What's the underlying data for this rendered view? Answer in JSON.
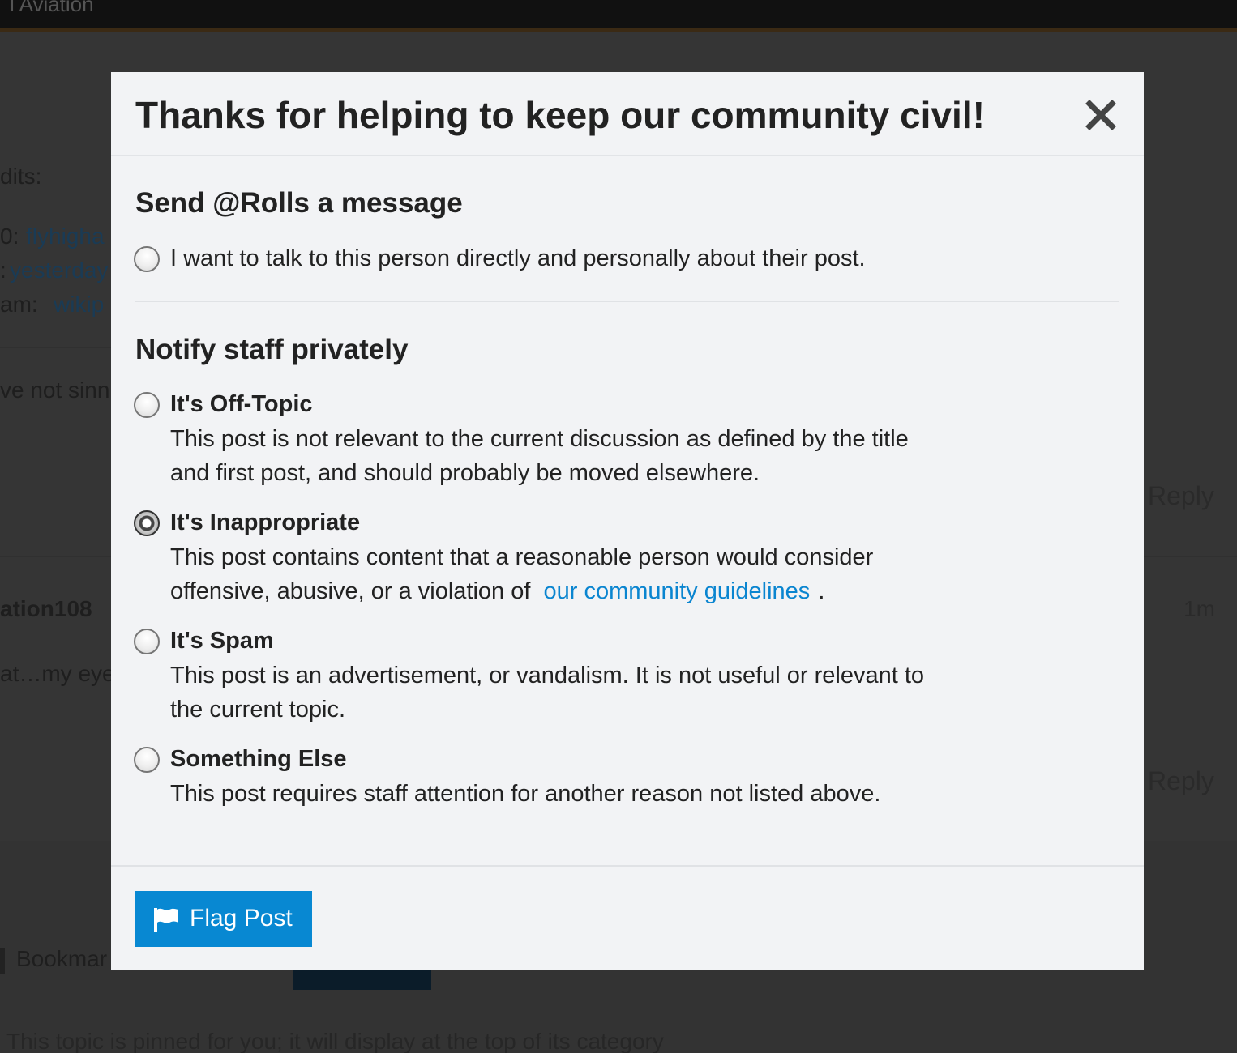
{
  "background": {
    "site_title": "l Aviation",
    "edits_label": "dits:",
    "edit_rows": [
      {
        "prefix": "0:",
        "link": "flyhigha"
      },
      {
        "prefix": ":",
        "link": "yesterday"
      },
      {
        "prefix": " am:",
        "link": "wikip"
      }
    ],
    "post_excerpt": "ve not sinn",
    "reply_1": "Reply",
    "username": "ation108",
    "post_time": "1m",
    "post_excerpt_2": "at…my eye",
    "reply_2": "Reply",
    "bookmark_label": "Bookmar",
    "pinned_notice": "This topic is pinned for you; it will display at the top of its category"
  },
  "modal": {
    "title": "Thanks for helping to keep our community civil!",
    "close_icon": "close-x-icon",
    "message_section": {
      "title": "Send @Rolls a message",
      "option_label": "I want to talk to this person directly and personally about their post.",
      "checked": false
    },
    "staff_section": {
      "title": "Notify staff privately",
      "options": [
        {
          "label": "It's Off-Topic",
          "desc_line1": "This post is not relevant to the current discussion as defined by the title",
          "desc_line2": "and first post, and should probably be moved elsewhere.",
          "checked": false
        },
        {
          "label": "It's Inappropriate",
          "desc_line1": "This post contains content that a reasonable person would consider",
          "desc_line2_prefix": "offensive, abusive, or a violation of",
          "desc_link": "our community guidelines",
          "desc_line2_suffix": ".",
          "checked": true
        },
        {
          "label": "It's Spam",
          "desc_line1": "This post is an advertisement, or vandalism. It is not useful or relevant to",
          "desc_line2": "the current topic.",
          "checked": false
        },
        {
          "label": "Something Else",
          "desc_line1": "This post requires staff attention for another reason not listed above.",
          "checked": false
        }
      ]
    },
    "footer": {
      "flag_button_label": "Flag Post",
      "flag_icon": "flag-icon"
    }
  },
  "colors": {
    "primary": "#0888d2",
    "link": "#0a85d0",
    "modal_bg": "#f2f3f5",
    "overlay_bg": "#353535"
  }
}
